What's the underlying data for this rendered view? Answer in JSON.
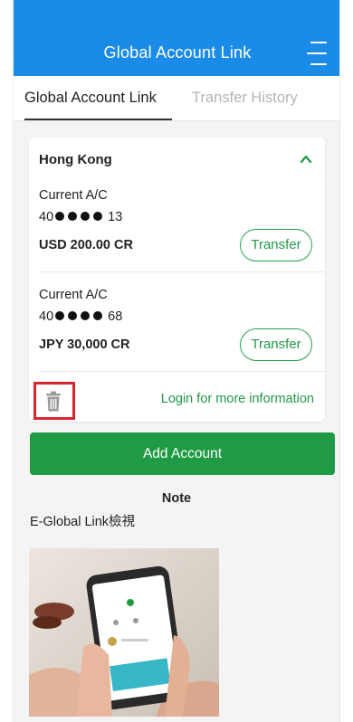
{
  "header": {
    "title": "Global Account Link",
    "menu_icon": "hamburger-menu-icon"
  },
  "tabs": [
    {
      "label": "Global Account Link",
      "active": true
    },
    {
      "label": "Transfer History",
      "active": false
    }
  ],
  "card": {
    "region": "Hong Kong",
    "accounts": [
      {
        "type": "Current A/C",
        "prefix": "40",
        "suffix": "13",
        "balance": "USD 200.00 CR",
        "transfer_label": "Transfer"
      },
      {
        "type": "Current A/C",
        "prefix": "40",
        "suffix": "68",
        "balance": "JPY 30,000 CR",
        "transfer_label": "Transfer"
      }
    ],
    "login_link": "Login for more information"
  },
  "add_account_label": "Add Account",
  "note": {
    "title": "Note",
    "text": "E-Global Link檢視"
  },
  "colors": {
    "header_blue": "#1a8ce8",
    "brand_green": "#1f9a45",
    "highlight_red": "#d9262c"
  }
}
